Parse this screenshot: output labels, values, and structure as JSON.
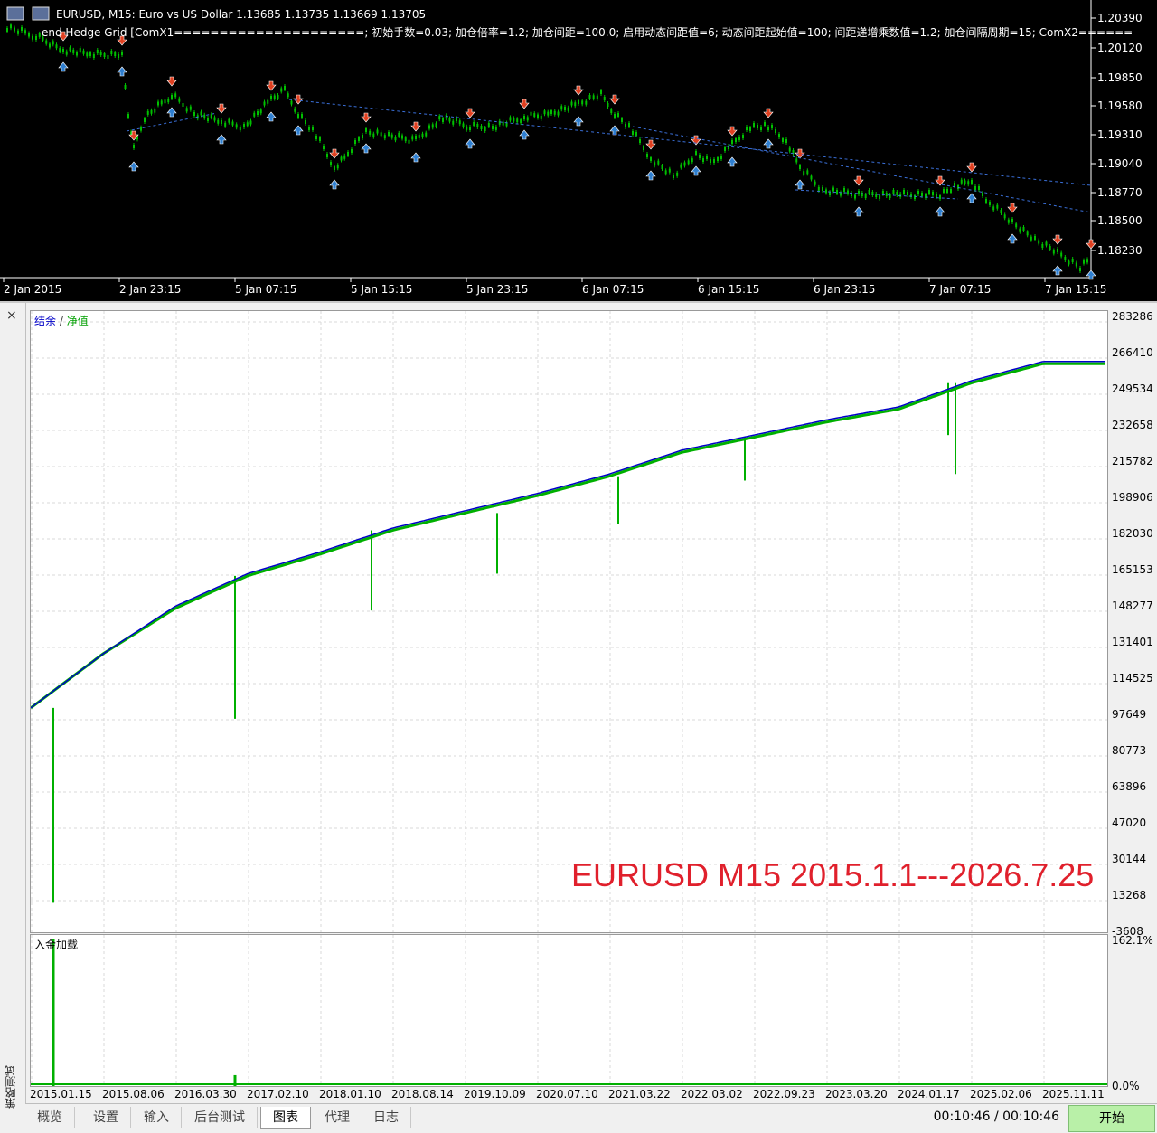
{
  "top_chart": {
    "title": "EURUSD, M15:  Euro vs US Dollar  1.13685 1.13735 1.13669 1.13705",
    "ea_params": "Trend Hedge Grid [ComX1=====================; 初始手数=0.03; 加仓倍率=1.2; 加仓间距=100.0; 启用动态间距值=6; 动态间距起始值=100; 间距递增乘数值=1.2; 加仓间隔周期=15; ComX2======",
    "ea_params_visible_start": "end Hedge Grid [ComX1=====================; 初始手数=0.03; 加仓倍率=1.2; 加仓间距=100.0; 启用动态间距值=6; 动态间距起始值=100; 间距递增乘数值=1.2; 加仓间隔周期=15; ComX2======",
    "price_levels": [
      "1.20390",
      "1.20120",
      "1.19850",
      "1.19580",
      "1.19310",
      "1.19040",
      "1.18770",
      "1.18500",
      "1.18230"
    ],
    "time_labels": [
      "2 Jan 2015",
      "2 Jan 23:15",
      "5 Jan 07:15",
      "5 Jan 15:15",
      "5 Jan 23:15",
      "6 Jan 07:15",
      "6 Jan 15:15",
      "6 Jan 23:15",
      "7 Jan 07:15",
      "7 Jan 15:15"
    ],
    "colors": {
      "background": "#000000",
      "candle": "#00c000",
      "buy_arrow": "#2f7fd0",
      "sell_arrow": "#e04020"
    }
  },
  "tester": {
    "balance_legend_balance": "结余",
    "balance_legend_sep": " / ",
    "balance_legend_equity": "净值",
    "deposit_legend": "入金加载",
    "side_label": "策略测试",
    "close_icon": "×",
    "watermark": "EURUSD M15 2015.1.1---2026.7.25",
    "y_labels": [
      "283286",
      "266410",
      "249534",
      "232658",
      "215782",
      "198906",
      "182030",
      "165153",
      "148277",
      "131401",
      "114525",
      "97649",
      "80773",
      "63896",
      "47020",
      "30144",
      "13268",
      "-3608"
    ],
    "dep_y_labels": [
      "162.1%",
      "0.0%"
    ],
    "x_labels": [
      "2015.01.15",
      "2015.08.06",
      "2016.03.30",
      "2017.02.10",
      "2018.01.10",
      "2018.08.14",
      "2019.10.09",
      "2020.07.10",
      "2021.03.22",
      "2022.03.02",
      "2022.09.23",
      "2023.03.20",
      "2024.01.17",
      "2025.02.06",
      "2025.11.11"
    ],
    "tabs": [
      "概览",
      "设置",
      "输入",
      "后台测试",
      "图表",
      "代理",
      "日志"
    ],
    "active_tab": "图表",
    "timer": "00:10:46 / 00:10:46",
    "start_button": "开始",
    "colors": {
      "balance": "#0000c8",
      "equity": "#00b000",
      "grid": "#d8d8d8",
      "start_button": "#b9f0a8"
    }
  },
  "chart_data": [
    {
      "type": "line",
      "title": "",
      "legend": [
        "结余",
        "净值"
      ],
      "ylim": [
        -3608,
        283286
      ],
      "x": [
        "2015.01.15",
        "2015.08.06",
        "2016.03.30",
        "2017.02.10",
        "2018.01.10",
        "2018.08.14",
        "2019.10.09",
        "2020.07.10",
        "2021.03.22",
        "2022.03.02",
        "2022.09.23",
        "2023.03.20",
        "2024.01.17",
        "2025.02.06",
        "2025.11.11"
      ],
      "series": [
        {
          "name": "结余",
          "values": [
            100000,
            125000,
            147000,
            162000,
            172000,
            183000,
            191000,
            199000,
            208000,
            219000,
            226000,
            233000,
            239000,
            251000,
            260000
          ]
        },
        {
          "name": "净值",
          "values": [
            100000,
            125000,
            146000,
            161000,
            171000,
            182000,
            190000,
            198000,
            207000,
            218000,
            225000,
            232000,
            238000,
            250000,
            259000
          ]
        }
      ],
      "equity_drawdowns": [
        {
          "date": "2015.01.15",
          "low": 10000
        },
        {
          "date": "2016.03.30",
          "low": 95000
        },
        {
          "date": "2017.02.10",
          "low": 145000
        },
        {
          "date": "2018.08.14",
          "low": 162000
        },
        {
          "date": "2019.10.09",
          "low": 185000
        },
        {
          "date": "2021.03.22",
          "low": 205000
        },
        {
          "date": "2024.01.17",
          "low": 226000
        },
        {
          "date": "2024.09.01",
          "low": 208000
        }
      ]
    },
    {
      "type": "bar",
      "title": "",
      "legend": [
        "入金加载"
      ],
      "ylim": [
        0.0,
        162.1
      ],
      "spikes": [
        {
          "date": "2015.01.15",
          "value": 162.1
        },
        {
          "date": "2016.03.30",
          "value": 12.0
        }
      ]
    }
  ]
}
